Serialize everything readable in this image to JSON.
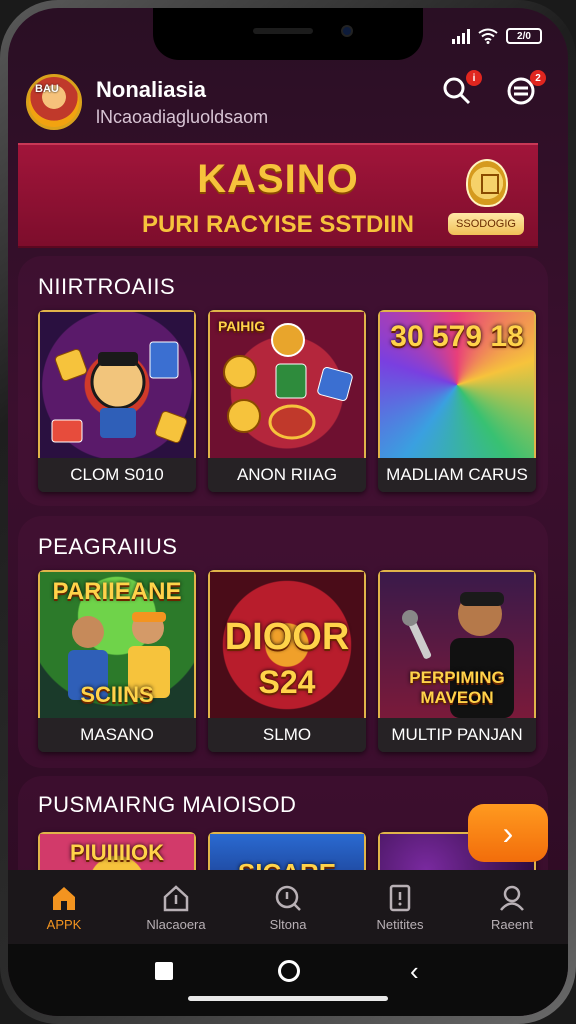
{
  "header": {
    "title": "Nonaliasia",
    "subtitle": "lNcaoadiagluoldsaom",
    "avatar_label": "BAU",
    "search_badge": "i",
    "menu_badge": "2"
  },
  "status": {
    "battery": "2/0"
  },
  "banner": {
    "title": "KASINO",
    "subtitle": "PURI RACYISE SSTDIIN",
    "pill": "SSODOGIG"
  },
  "sections": [
    {
      "title": "NIIRTROAIIS",
      "cards": [
        {
          "label": "CLOM S010",
          "art_text": ""
        },
        {
          "label": "ANON RIIAG",
          "art_text": "PAIHIG"
        },
        {
          "label": "MADLIAM CARUS",
          "art_text": "30 579 18"
        }
      ]
    },
    {
      "title": "PEAGRAIIUS",
      "cards": [
        {
          "label": "MASANO",
          "art_text": "PARIIEANE",
          "art_sub": "SCIINS"
        },
        {
          "label": "SLMO",
          "art_text": "DIOOR",
          "art_sub": "S24"
        },
        {
          "label": "MULTIP PANJAN",
          "art_text": "PERPIMING",
          "art_sub": "MAVEON"
        }
      ]
    },
    {
      "title": "PUSMAIRNG MAIOISOD",
      "cards": [
        {
          "label": "",
          "art_text": "PIUIIIIOK"
        },
        {
          "label": "",
          "art_text": "SICARE"
        },
        {
          "label": "",
          "art_text": ""
        }
      ]
    }
  ],
  "fab": {
    "label": "›"
  },
  "nav": [
    {
      "label": "APPK",
      "icon": "home-icon",
      "active": true
    },
    {
      "label": "Nlacaoera",
      "icon": "share-icon"
    },
    {
      "label": "Sltona",
      "icon": "search-icon"
    },
    {
      "label": "Netitites",
      "icon": "notification-icon"
    },
    {
      "label": "Raeent",
      "icon": "profile-icon"
    }
  ],
  "colors": {
    "accent": "#f39420",
    "banner": "#a1153a",
    "gold": "#f6c33c"
  }
}
